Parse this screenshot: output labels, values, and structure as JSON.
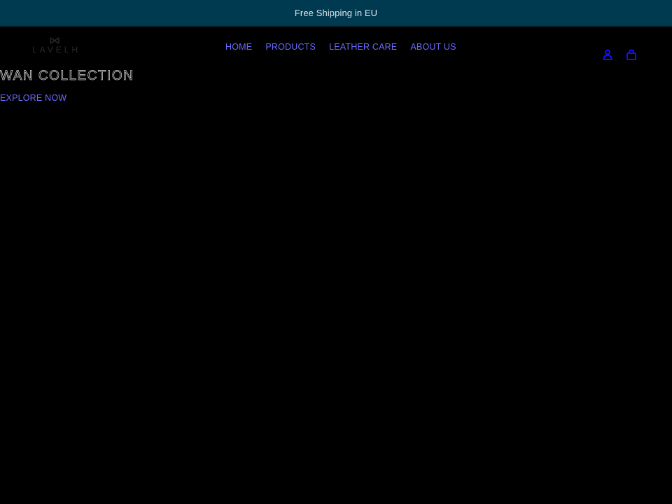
{
  "announcement": {
    "text": "Free Shipping in EU"
  },
  "brand": {
    "name": "LAVELH",
    "logo_icon": "lavelh-bowtie-logo-icon"
  },
  "nav": {
    "items": [
      {
        "label": "HOME"
      },
      {
        "label": "PRODUCTS"
      },
      {
        "label": "LEATHER CARE"
      },
      {
        "label": "ABOUT US"
      }
    ]
  },
  "header_icons": {
    "account": "account-icon",
    "cart": "cart-icon",
    "color": "#1010ff"
  },
  "hero": {
    "title": "WAN COLLECTION",
    "cta_label": "EXPLORE NOW"
  }
}
